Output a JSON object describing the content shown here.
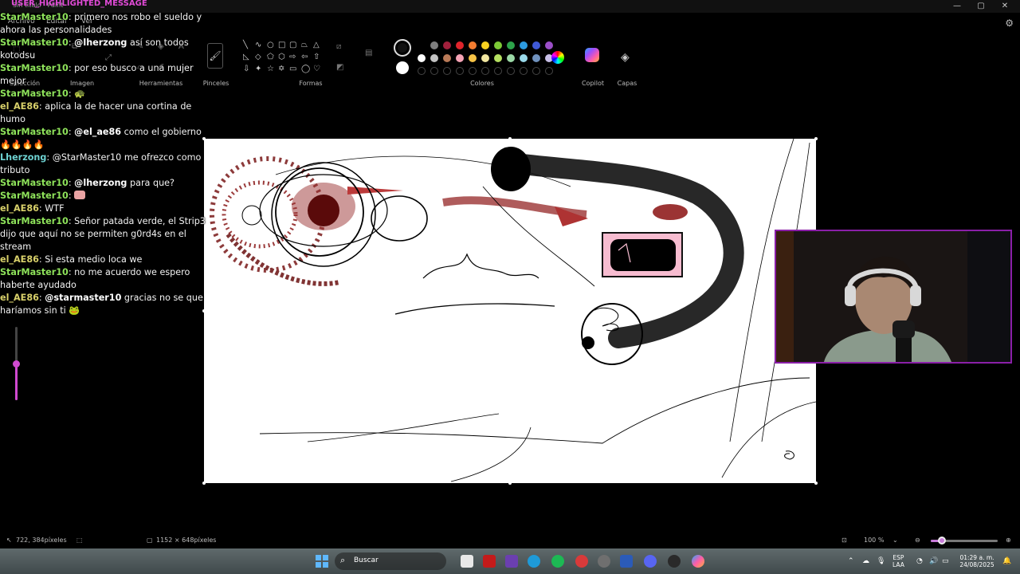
{
  "window": {
    "title": "Sin título - Paint",
    "min": "—",
    "max": "▢",
    "close": "✕"
  },
  "menu": [
    "Archivo",
    "Editar",
    "Ver"
  ],
  "ribbon": {
    "groups": [
      "Selección",
      "Imagen",
      "Herramientas",
      "Pinceles",
      "Formas",
      "Colores",
      "Copilot",
      "Capas"
    ]
  },
  "colors": {
    "current_primary": "#111111",
    "current_secondary": "#ffffff",
    "row1": [
      "#000000",
      "#7f7f7f",
      "#a0203c",
      "#e0242b",
      "#f47c30",
      "#f8d020",
      "#7dca36",
      "#2da34a",
      "#2c9ae0",
      "#3f59d6",
      "#9b4fc8"
    ],
    "row2": [
      "#ffffff",
      "#c3c3c3",
      "#b97a57",
      "#f5a3b5",
      "#f7c346",
      "#f2e7a0",
      "#b5e061",
      "#9bd9a6",
      "#99d9ea",
      "#7092be",
      "#c8bfe7"
    ]
  },
  "chat": {
    "header": "USER_HIGHLIGHTED_MESSAGE",
    "messages": [
      {
        "user": "StarMaster10",
        "style": "star",
        "mention": "",
        "text": ": primero nos robo el sueldo y"
      },
      {
        "user": "",
        "style": "",
        "mention": "",
        "text": "ahora las personalidades"
      },
      {
        "user": "StarMaster10",
        "style": "star",
        "mention": "@lherzong",
        "text": " así son todos"
      },
      {
        "user": "",
        "style": "",
        "mention": "",
        "text": "kotodsu"
      },
      {
        "user": "StarMaster10",
        "style": "star",
        "mention": "",
        "text": ": por eso busco a una mujer"
      },
      {
        "user": "",
        "style": "",
        "mention": "",
        "text": "mejor"
      },
      {
        "user": "StarMaster10",
        "style": "star",
        "mention": "",
        "text": ": 🐢"
      },
      {
        "user": "el_AE86",
        "style": "el",
        "mention": "",
        "text": ": aplica la de hacer una cortina de"
      },
      {
        "user": "",
        "style": "",
        "mention": "",
        "text": "humo"
      },
      {
        "user": "StarMaster10",
        "style": "star",
        "mention": "@el_ae86",
        "text": " como el gobierno"
      },
      {
        "user": "",
        "style": "",
        "mention": "",
        "text": "🔥🔥🔥🔥"
      },
      {
        "user": "Lherzong",
        "style": "lher",
        "mention": "",
        "text": ": @StarMaster10 me ofrezco como"
      },
      {
        "user": "",
        "style": "",
        "mention": "",
        "text": "tributo"
      },
      {
        "user": "StarMaster10",
        "style": "star",
        "mention": "@lherzong",
        "text": " para que?"
      },
      {
        "user": "StarMaster10",
        "style": "star",
        "mention": "",
        "text": ": "
      },
      {
        "user": "el_AE86",
        "style": "el",
        "mention": "",
        "text": ": WTF"
      },
      {
        "user": "StarMaster10",
        "style": "star",
        "mention": "",
        "text": ": Señor patada verde, el Strip3"
      },
      {
        "user": "",
        "style": "",
        "mention": "",
        "text": "dijo que aquí no se permiten g0rd4s en el"
      },
      {
        "user": "",
        "style": "",
        "mention": "",
        "text": "stream"
      },
      {
        "user": "el_AE86",
        "style": "el",
        "mention": "",
        "text": ": Si esta medio loca we"
      },
      {
        "user": "StarMaster10",
        "style": "star",
        "mention": "",
        "text": ": no me acuerdo we espero"
      },
      {
        "user": "",
        "style": "",
        "mention": "",
        "text": "haberte ayudado"
      },
      {
        "user": "el_AE86",
        "style": "el",
        "mention": "@starmaster10",
        "text": " gracias no se que"
      },
      {
        "user": "",
        "style": "",
        "mention": "",
        "text": "haríamos sin ti 🐸"
      }
    ]
  },
  "statusbar": {
    "cursor_pos": "722, 384píxeles",
    "canvas_size": "1152 × 648píxeles",
    "zoom": "100 %",
    "zoom_level_fraction": 0.17
  },
  "taskbar": {
    "search_placeholder": "Buscar",
    "lang_top": "ESP",
    "lang_bottom": "LAA",
    "time": "01:29 a. m.",
    "date": "24/08/2025"
  },
  "icons": {
    "search": "search-icon",
    "gear": "gear-icon",
    "layers": "layers-icon",
    "copilot": "copilot-icon",
    "windows": "windows-start-icon"
  }
}
